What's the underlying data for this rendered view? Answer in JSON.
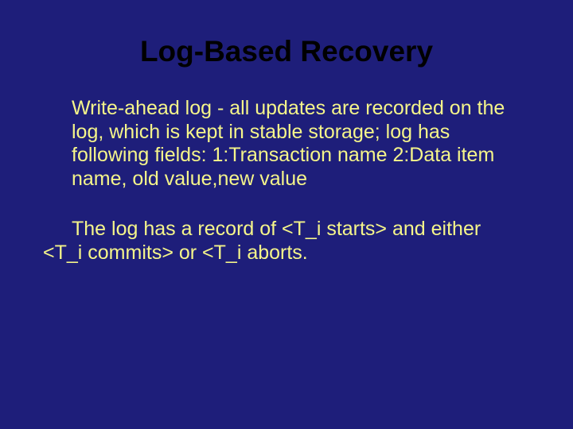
{
  "slide": {
    "title": "Log-Based Recovery",
    "para1": "Write-ahead log - all updates are recorded on the log, which is kept in stable storage; log has following fields: 1:Transaction name 2:Data item name, old value,new value",
    "para2_line1": "The log has a record of <T_i starts> and either",
    "para2_line2": "<T_i commits> or <T_i aborts."
  }
}
